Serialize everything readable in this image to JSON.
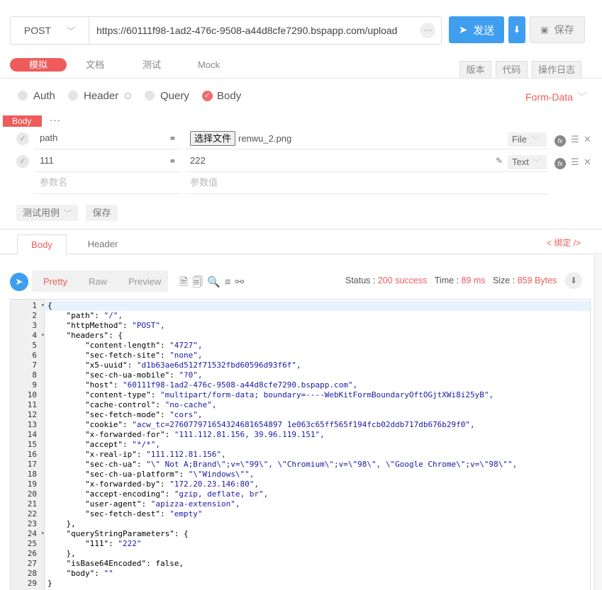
{
  "request": {
    "method": "POST",
    "url": "https://60111f98-1ad2-476c-9508-a44d8cfe7290.bspapp.com/upload",
    "more_label": "···",
    "send_label": "发送",
    "save_label": "保存"
  },
  "main_tabs": [
    "模拟",
    "文档",
    "测试",
    "Mock"
  ],
  "right_tabs": [
    "版本",
    "代码",
    "操作日志"
  ],
  "sections": [
    "Auth",
    "Header",
    "Query",
    "Body"
  ],
  "body_mode": "Form-Data",
  "body_tag": "Body",
  "body_more": "···",
  "params": [
    {
      "name": "path",
      "file_button": "选择文件",
      "value": "renwu_2.png",
      "type": "File"
    },
    {
      "name": "111",
      "value": "222",
      "type": "Text"
    }
  ],
  "placeholders": {
    "name": "参数名",
    "value": "参数值"
  },
  "test_case_label": "测试用例",
  "save_case_label": "保存",
  "response": {
    "tabs": [
      "Body",
      "Header"
    ],
    "bind_label": "< 绑定 />",
    "formats": [
      "Pretty",
      "Raw",
      "Preview"
    ],
    "status_label": "Status : ",
    "status_value": "200 success",
    "time_label": "Time : ",
    "time_value": "89 ms",
    "size_label": "Size : ",
    "size_value": "859 Bytes"
  },
  "code_lines": [
    "{",
    "    \"path\": \"/\",",
    "    \"httpMethod\": \"POST\",",
    "    \"headers\": {",
    "        \"content-length\": \"4727\",",
    "        \"sec-fetch-site\": \"none\",",
    "        \"x5-uuid\": \"d1b63ae6d512f71532fbd60596d93f6f\",",
    "        \"sec-ch-ua-mobile\": \"?0\",",
    "        \"host\": \"60111f98-1ad2-476c-9508-a44d8cfe7290.bspapp.com\",",
    "        \"content-type\": \"multipart/form-data; boundary=----WebKitFormBoundaryOftOGjtXWi8i25yB\",",
    "        \"cache-control\": \"no-cache\",",
    "        \"sec-fetch-mode\": \"cors\",",
    "        \"cookie\": \"acw_tc=276077971654324681654897 1e063c65ff565f194fcb02ddb717db676b29f0\",",
    "        \"x-forwarded-for\": \"111.112.81.156, 39.96.119.151\",",
    "        \"accept\": \"*/*\",",
    "        \"x-real-ip\": \"111.112.81.156\",",
    "        \"sec-ch-ua\": \"\\\" Not A;Brand\\\";v=\\\"99\\\", \\\"Chromium\\\";v=\\\"98\\\", \\\"Google Chrome\\\";v=\\\"98\\\"\",",
    "        \"sec-ch-ua-platform\": \"\\\"Windows\\\"\",",
    "        \"x-forwarded-by\": \"172.20.23.146:80\",",
    "        \"accept-encoding\": \"gzip, deflate, br\",",
    "        \"user-agent\": \"apizza-extension\",",
    "        \"sec-fetch-dest\": \"empty\"",
    "    },",
    "    \"queryStringParameters\": {",
    "        \"111\": \"222\"",
    "    },",
    "    \"isBase64Encoded\": false,",
    "    \"body\": \"\"",
    "}"
  ],
  "fold_lines": [
    1,
    4,
    24
  ]
}
